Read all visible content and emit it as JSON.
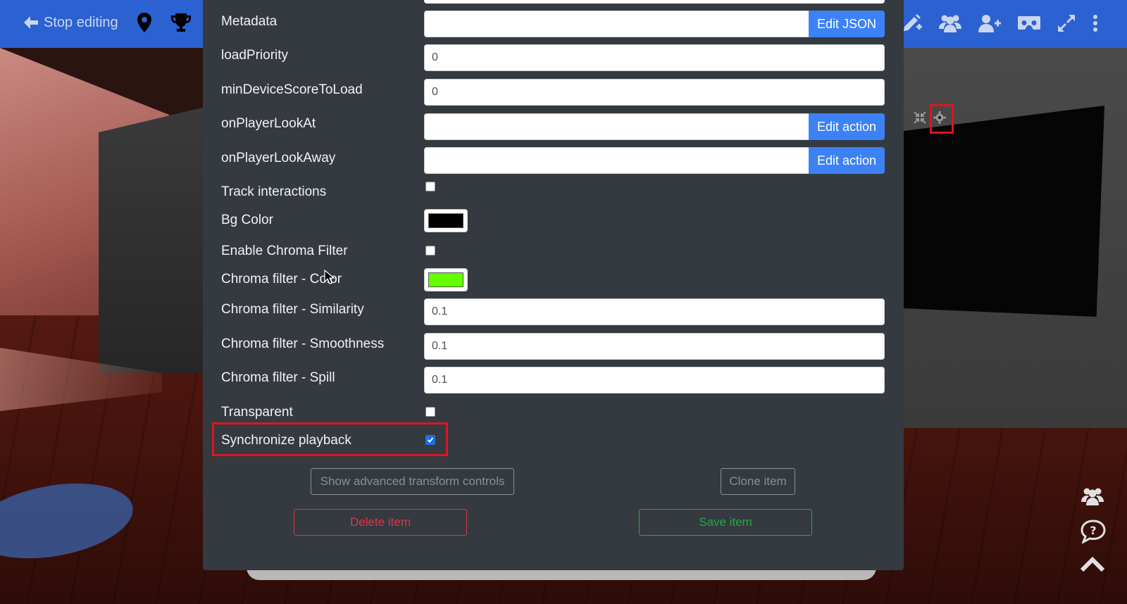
{
  "nav": {
    "stop_editing_label": "Stop editing",
    "left_icons": [
      "arrow-left-icon",
      "map-marker-icon",
      "trophy-icon"
    ],
    "right_icons": [
      "edit-plus-icon",
      "users-icon",
      "user-plus-icon",
      "vr-headset-icon",
      "expand-icon",
      "more-vertical-icon"
    ]
  },
  "form": {
    "fields": [
      {
        "label": "Metadata",
        "type": "button-group",
        "button": "Edit JSON"
      },
      {
        "label": "loadPriority",
        "type": "text",
        "value": "0"
      },
      {
        "label": "minDeviceScoreToLoad",
        "type": "text",
        "value": "0"
      },
      {
        "label": "onPlayerLookAt",
        "type": "button-group",
        "button": "Edit action"
      },
      {
        "label": "onPlayerLookAway",
        "type": "button-group",
        "button": "Edit action"
      },
      {
        "label": "Track interactions",
        "type": "checkbox",
        "checked": false
      },
      {
        "label": "Bg Color",
        "type": "color",
        "color": "#000000"
      },
      {
        "label": "Enable Chroma Filter",
        "type": "checkbox",
        "checked": false
      },
      {
        "label": "Chroma filter - Color",
        "type": "color",
        "color": "#66ff00"
      },
      {
        "label": "Chroma filter - Similarity",
        "type": "text",
        "value": "0.1"
      },
      {
        "label": "Chroma filter - Smoothness",
        "type": "text",
        "value": "0.1"
      },
      {
        "label": "Chroma filter - Spill",
        "type": "text",
        "value": "0.1"
      },
      {
        "label": "Transparent",
        "type": "checkbox",
        "checked": false
      },
      {
        "label": "Synchronize playback",
        "type": "checkbox",
        "checked": true
      }
    ],
    "buttons": {
      "advanced": "Show advanced transform controls",
      "clone": "Clone item",
      "delete": "Delete item",
      "save": "Save item"
    }
  },
  "colors": {
    "nav_bg": "#2c61d2",
    "panel_bg": "#343a40",
    "primary": "#3c82f6",
    "danger": "#dc3545",
    "success": "#28a745",
    "highlight": "#e0141e"
  },
  "scene_icons": [
    "compress-icon",
    "gear-icon"
  ],
  "side_icons": [
    "users-icon",
    "help-chat-icon",
    "chevron-up-icon"
  ]
}
